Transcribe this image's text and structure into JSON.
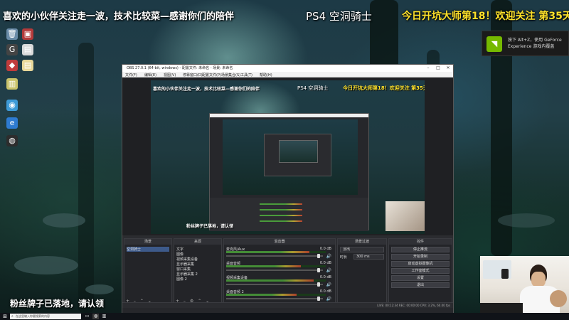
{
  "overlay": {
    "top_banner": "喜欢的小伙伴关注走一波，技术比较菜—感谢你们的陪伴",
    "ps4_title": "PS4 空洞骑士",
    "right_banner": "今日开坑大师第18！欢迎关注 第35天",
    "bottom_banner": "粉丝牌子已落地，请认领"
  },
  "nvidia_toast": {
    "message": "按下 Alt+Z，使用 GeForce Experience 游戏内覆盖"
  },
  "desktop_icons": [
    {
      "icon": "recycle-bin-icon",
      "glyph": "🗑"
    },
    {
      "icon": "app-icon",
      "glyph": "▣"
    },
    {
      "icon": "logitech-icon",
      "glyph": "G"
    },
    {
      "icon": "file-icon",
      "glyph": "▤"
    },
    {
      "icon": "app-icon",
      "glyph": "◆"
    },
    {
      "icon": "file-icon",
      "glyph": "▤"
    },
    {
      "icon": "folder-icon",
      "glyph": "▥"
    },
    {
      "icon": "chrome-icon",
      "glyph": "◉"
    },
    {
      "icon": "edge-icon",
      "glyph": "e"
    },
    {
      "icon": "obs-icon",
      "glyph": "◍"
    }
  ],
  "obs": {
    "title": "OBS 27.0.1 (64-bit, windows) - 配置文件: 未命名 - 场景: 未命名",
    "menu": [
      "文件(F)",
      "编辑(E)",
      "视图(V)",
      "停靠窗口(D)",
      "配置文件(P)",
      "场景集合(S)",
      "工具(T)",
      "帮助(H)"
    ],
    "preview": {
      "top_text": "喜欢的小伙伴关注走一波，技术比较菜—感谢你们的陪伴",
      "ps4_title": "PS4 空洞骑士",
      "right_text": "今日开坑大师第18！欢迎关注 第35天",
      "bottom_text": "粉丝牌子已落地，请认领"
    },
    "docks": {
      "scenes_title": "场景",
      "scenes": [
        "空洞骑士"
      ],
      "sources_title": "来源",
      "sources": [
        "文字",
        "图像",
        "视频采集设备",
        "显示器采集",
        "窗口采集",
        "显示器采集 2",
        "图像 2"
      ],
      "mixer_title": "混音器",
      "mixer": [
        {
          "name": "麦克风/Aux",
          "db": "0.0 dB"
        },
        {
          "name": "桌面音频",
          "db": "0.0 dB"
        },
        {
          "name": "视频采集设备",
          "db": "0.0 dB"
        },
        {
          "name": "桌面音频 2",
          "db": "0.0 dB"
        }
      ],
      "transitions_title": "场景过渡",
      "transition_type": "淡出",
      "duration_label": "时长",
      "duration_value": "300 ms",
      "controls_title": "控件",
      "controls": [
        "停止推流",
        "开始录制",
        "启动虚拟摄像机",
        "工作室模式",
        "设置",
        "退出"
      ]
    },
    "status": "LIVE: 00:12:34  REC: 00:00:00  CPU: 3.2%, 60.00 fps"
  },
  "taskbar": {
    "search_placeholder": "在这里输入你要搜索的内容"
  }
}
